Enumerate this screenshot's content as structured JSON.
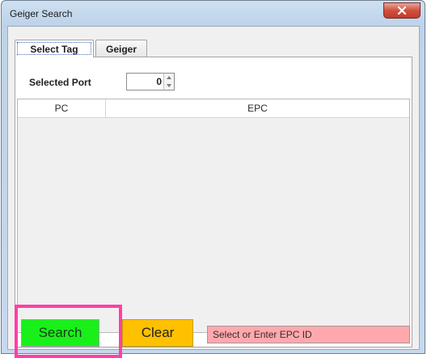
{
  "window": {
    "title": "Geiger Search"
  },
  "tabs": [
    {
      "label": "Select Tag",
      "selected": true
    },
    {
      "label": "Geiger",
      "selected": false
    }
  ],
  "selected_port": {
    "label": "Selected Port",
    "value": "0"
  },
  "tag_table": {
    "columns": [
      "PC",
      "EPC"
    ],
    "rows": []
  },
  "actions": {
    "search_label": "Search",
    "clear_label": "Clear"
  },
  "epc_input": {
    "value": "Select or Enter EPC ID"
  },
  "colors": {
    "search_bg": "#19f019",
    "clear_bg": "#ffc000",
    "epc_input_bg": "#ffa9ae",
    "highlight_border": "#ff3fa8"
  },
  "icons": {
    "close": "close-icon",
    "spin_up": "arrow-up-icon",
    "spin_down": "arrow-down-icon"
  }
}
